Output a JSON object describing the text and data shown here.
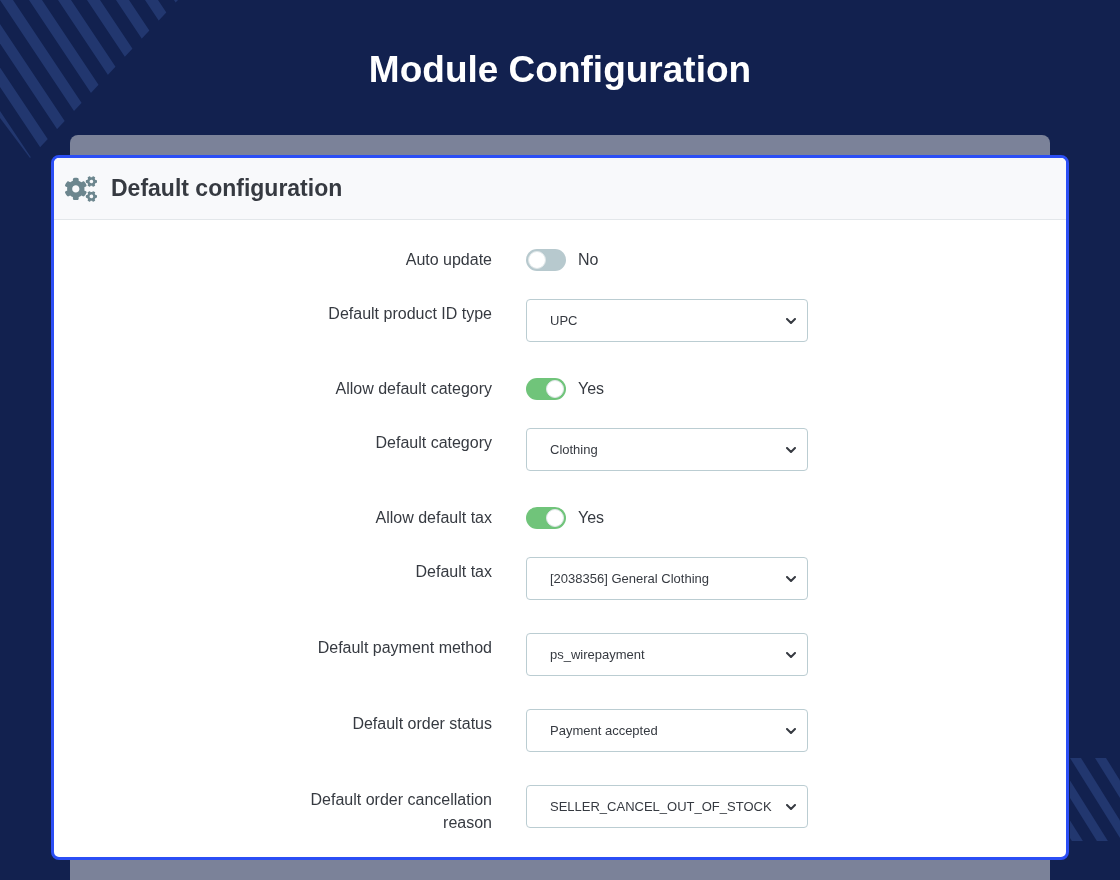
{
  "page": {
    "title": "Module Configuration"
  },
  "card": {
    "title": "Default configuration"
  },
  "rows": [
    {
      "kind": "toggle",
      "label": "Auto update",
      "on": false,
      "value": "No"
    },
    {
      "kind": "select",
      "label": "Default product ID type",
      "value": "UPC"
    },
    {
      "kind": "toggle",
      "label": "Allow default category",
      "on": true,
      "value": "Yes"
    },
    {
      "kind": "select",
      "label": "Default category",
      "value": "Clothing"
    },
    {
      "kind": "toggle",
      "label": "Allow default tax",
      "on": true,
      "value": "Yes"
    },
    {
      "kind": "select",
      "label": "Default tax",
      "value": "[2038356] General Clothing"
    },
    {
      "kind": "select",
      "label": "Default payment method",
      "value": "ps_wirepayment"
    },
    {
      "kind": "select",
      "label": "Default order status",
      "value": "Payment accepted"
    },
    {
      "kind": "select",
      "label": "Default order cancellation reason",
      "value": "SELLER_CANCEL_OUT_OF_STOCK"
    }
  ]
}
